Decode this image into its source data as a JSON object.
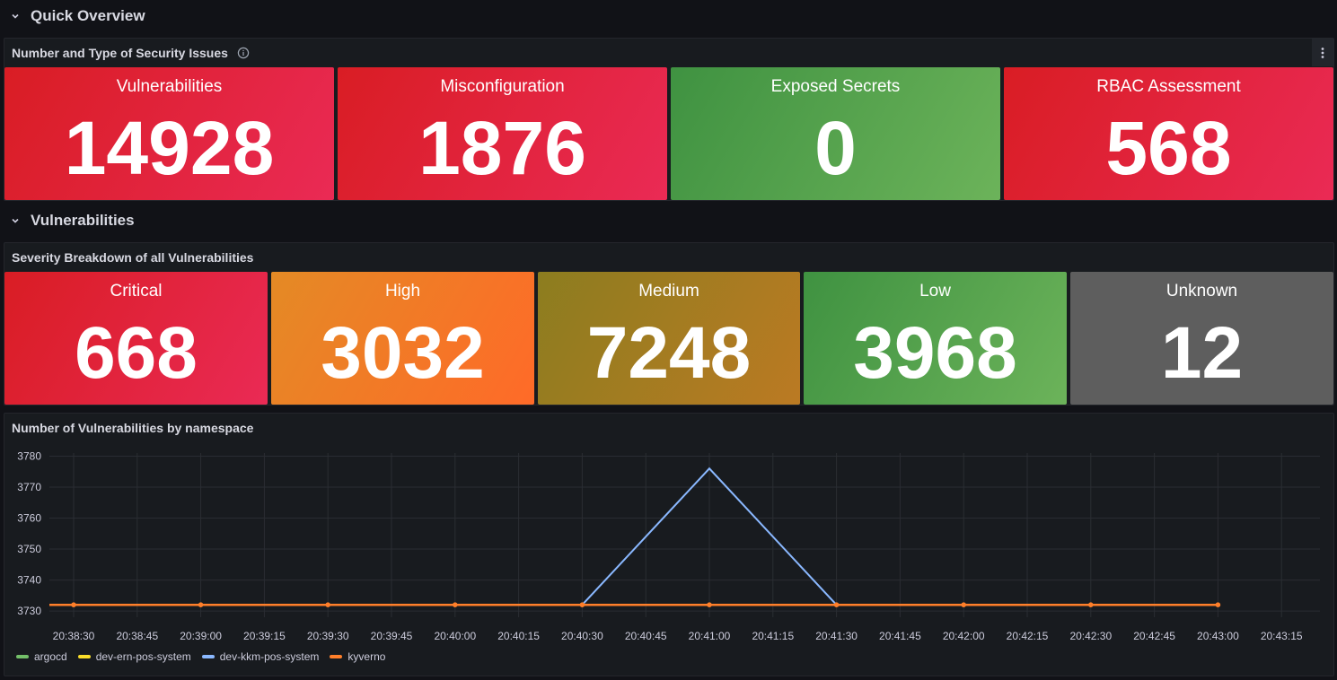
{
  "sections": {
    "quick_overview": "Quick Overview",
    "vulnerabilities": "Vulnerabilities"
  },
  "panel_issues": {
    "title": "Number and Type of Security Issues",
    "stats": [
      {
        "label": "Vulnerabilities",
        "value": "14928",
        "color": "red"
      },
      {
        "label": "Misconfiguration",
        "value": "1876",
        "color": "red"
      },
      {
        "label": "Exposed Secrets",
        "value": "0",
        "color": "green"
      },
      {
        "label": "RBAC Assessment",
        "value": "568",
        "color": "red"
      }
    ]
  },
  "panel_severity": {
    "title": "Severity Breakdown of all Vulnerabilities",
    "stats": [
      {
        "label": "Critical",
        "value": "668",
        "color": "red"
      },
      {
        "label": "High",
        "value": "3032",
        "color": "orange"
      },
      {
        "label": "Medium",
        "value": "7248",
        "color": "olive"
      },
      {
        "label": "Low",
        "value": "3968",
        "color": "green"
      },
      {
        "label": "Unknown",
        "value": "12",
        "color": "gray"
      }
    ]
  },
  "panel_namespace": {
    "title": "Number of Vulnerabilities by namespace"
  },
  "chart_data": {
    "type": "line",
    "title": "Number of Vulnerabilities by namespace",
    "xlabel": "",
    "ylabel": "",
    "x_ticks": [
      "20:38:30",
      "20:38:45",
      "20:39:00",
      "20:39:15",
      "20:39:30",
      "20:39:45",
      "20:40:00",
      "20:40:15",
      "20:40:30",
      "20:40:45",
      "20:41:00",
      "20:41:15",
      "20:41:30",
      "20:41:45",
      "20:42:00",
      "20:42:15",
      "20:42:30",
      "20:42:45",
      "20:43:00",
      "20:43:15"
    ],
    "y_ticks": [
      3730,
      3740,
      3750,
      3760,
      3770,
      3780
    ],
    "ylim": [
      3728,
      3781
    ],
    "x": [
      "20:38:30",
      "20:39:00",
      "20:39:30",
      "20:40:00",
      "20:40:30",
      "20:41:00",
      "20:41:30",
      "20:42:00",
      "20:42:30",
      "20:43:00"
    ],
    "series": [
      {
        "name": "argocd",
        "color": "#73bf69",
        "values": [
          null,
          null,
          null,
          null,
          null,
          null,
          null,
          null,
          null,
          null
        ]
      },
      {
        "name": "dev-ern-pos-system",
        "color": "#fade2a",
        "values": [
          null,
          null,
          null,
          null,
          null,
          null,
          null,
          null,
          null,
          null
        ]
      },
      {
        "name": "dev-kkm-pos-system",
        "color": "#8ab8ff",
        "values": [
          3732,
          3732,
          3732,
          3732,
          3732,
          3776,
          3732,
          3732,
          3732,
          3732
        ]
      },
      {
        "name": "kyverno",
        "color": "#ff7f2a",
        "values": [
          3732,
          3732,
          3732,
          3732,
          3732,
          3732,
          3732,
          3732,
          3732,
          3732
        ]
      }
    ],
    "grid": true,
    "legend": "bottom-left"
  },
  "colors": {
    "red": "#e02f44",
    "green": "#56a64b",
    "orange": "#ff7f2a",
    "olive": "#a47d22",
    "gray": "#5e5e5e",
    "background": "#111217",
    "panel": "#181b1f"
  }
}
